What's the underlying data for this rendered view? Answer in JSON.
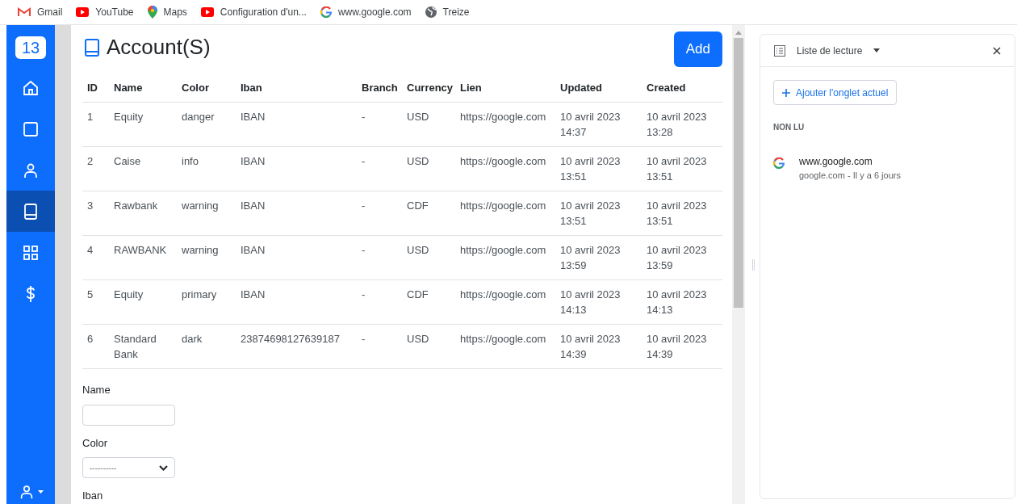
{
  "bookmarks": [
    {
      "kind": "gmail",
      "label": "Gmail"
    },
    {
      "kind": "youtube",
      "label": "YouTube"
    },
    {
      "kind": "maps",
      "label": "Maps"
    },
    {
      "kind": "youtube",
      "label": "Configuration d'un..."
    },
    {
      "kind": "google",
      "label": "www.google.com"
    },
    {
      "kind": "globe",
      "label": "Treize"
    }
  ],
  "sidebar": {
    "logo": "13",
    "items": [
      {
        "kind": "home",
        "selected": false
      },
      {
        "kind": "square",
        "selected": false
      },
      {
        "kind": "user",
        "selected": false
      },
      {
        "kind": "book",
        "selected": true
      },
      {
        "kind": "grid",
        "selected": false
      },
      {
        "kind": "dollar",
        "selected": false
      }
    ]
  },
  "page": {
    "title": "Account(S)",
    "add_button": "Add"
  },
  "table": {
    "columns": [
      "ID",
      "Name",
      "Color",
      "Iban",
      "Branch",
      "Currency",
      "Lien",
      "Updated",
      "Created"
    ],
    "rows": [
      [
        "1",
        "Equity",
        "danger",
        "IBAN",
        "-",
        "USD",
        "https://google.com",
        "10 avril 2023 14:37",
        "10 avril 2023 13:28"
      ],
      [
        "2",
        "Caise",
        "info",
        "IBAN",
        "-",
        "USD",
        "https://google.com",
        "10 avril 2023 13:51",
        "10 avril 2023 13:51"
      ],
      [
        "3",
        "Rawbank",
        "warning",
        "IBAN",
        "-",
        "CDF",
        "https://google.com",
        "10 avril 2023 13:51",
        "10 avril 2023 13:51"
      ],
      [
        "4",
        "RAWBANK",
        "warning",
        "IBAN",
        "-",
        "USD",
        "https://google.com",
        "10 avril 2023 13:59",
        "10 avril 2023 13:59"
      ],
      [
        "5",
        "Equity",
        "primary",
        "IBAN",
        "-",
        "CDF",
        "https://google.com",
        "10 avril 2023 14:13",
        "10 avril 2023 14:13"
      ],
      [
        "6",
        "Standard Bank",
        "dark",
        "23874698127639187",
        "-",
        "USD",
        "https://google.com",
        "10 avril 2023 14:39",
        "10 avril 2023 14:39"
      ]
    ]
  },
  "form": [
    {
      "kind": "text",
      "label": "Name"
    },
    {
      "kind": "select",
      "label": "Color",
      "value": "----------"
    },
    {
      "kind": "label",
      "label": "Iban"
    }
  ],
  "reading_list": {
    "title": "Liste de lecture",
    "add_button": "Ajouter l'onglet actuel",
    "section": "NON LU",
    "items": [
      {
        "title": "www.google.com",
        "subtitle": "google.com - Il y a 6 jours"
      }
    ]
  }
}
